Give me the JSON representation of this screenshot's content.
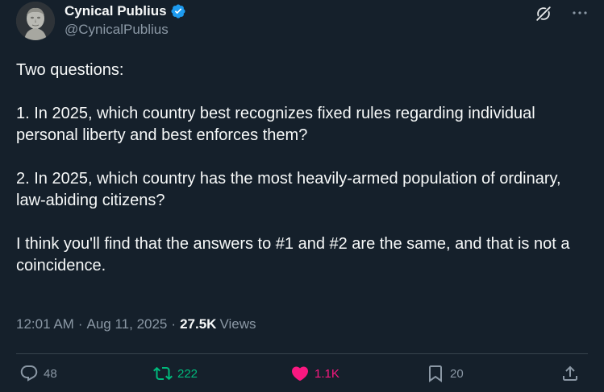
{
  "author": {
    "display_name": "Cynical Publius",
    "handle": "@CynicalPublius",
    "verified": true
  },
  "tweet": {
    "text": "Two questions:\n\n1. In 2025, which country best recognizes fixed rules regarding individual personal liberty and best enforces them?\n\n2. In 2025, which country has the most heavily-armed population of ordinary, law-abiding citizens?\n\nI think you'll find that the answers to #1 and #2 are the same, and that is not a coincidence.",
    "time": "12:01 AM",
    "date": "Aug 11, 2025",
    "separator": "·",
    "views_count": "27.5K",
    "views_label": "Views"
  },
  "actions": {
    "replies": "48",
    "retweets": "222",
    "likes": "1.1K",
    "bookmarks": "20"
  },
  "colors": {
    "background": "#15202b",
    "text": "#f7f9f9",
    "muted": "#8b98a5",
    "retweet": "#00ba7c",
    "like": "#f91880",
    "verified": "#1d9bf0"
  },
  "icons": [
    "verified-badge-icon",
    "grok-icon",
    "more-icon",
    "reply-icon",
    "retweet-icon",
    "like-icon",
    "bookmark-icon",
    "share-icon"
  ]
}
